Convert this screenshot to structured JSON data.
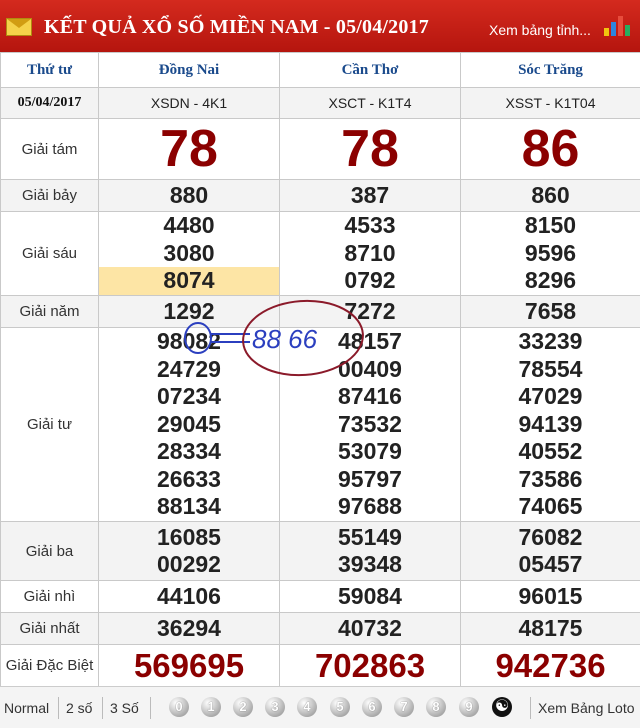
{
  "header": {
    "title": "KẾT QUẢ XỔ SỐ MIỀN NAM - 05/04/2017",
    "view_link": "Xem bảng tỉnh..."
  },
  "table": {
    "day": "Thứ tư",
    "date": "05/04/2017",
    "provinces": [
      {
        "name": "Đồng Nai",
        "code": "XSDN - 4K1"
      },
      {
        "name": "Cần Thơ",
        "code": "XSCT - K1T4"
      },
      {
        "name": "Sóc Trăng",
        "code": "XSST - K1T04"
      }
    ],
    "prizes": {
      "g8": {
        "label": "Giải tám",
        "values": [
          "78",
          "78",
          "86"
        ]
      },
      "g7": {
        "label": "Giải bảy",
        "values": [
          "880",
          "387",
          "860"
        ]
      },
      "g6": {
        "label": "Giải sáu",
        "values": [
          [
            "4480",
            "3080",
            "8074"
          ],
          [
            "4533",
            "8710",
            "0792"
          ],
          [
            "8150",
            "9596",
            "8296"
          ]
        ]
      },
      "g5": {
        "label": "Giải năm",
        "values": [
          "1292",
          "7272",
          "7658"
        ]
      },
      "g4": {
        "label": "Giải tư",
        "values": [
          [
            "98082",
            "24729",
            "07234",
            "29045",
            "28334",
            "26633",
            "88134"
          ],
          [
            "48157",
            "00409",
            "87416",
            "73532",
            "53079",
            "95797",
            "97688"
          ],
          [
            "33239",
            "78554",
            "47029",
            "94139",
            "40552",
            "73586",
            "74065"
          ]
        ]
      },
      "g3": {
        "label": "Giải ba",
        "values": [
          [
            "16085",
            "00292"
          ],
          [
            "55149",
            "39348"
          ],
          [
            "76082",
            "05457"
          ]
        ]
      },
      "g2": {
        "label": "Giải nhì",
        "values": [
          "44106",
          "59084",
          "96015"
        ]
      },
      "g1": {
        "label": "Giải nhất",
        "values": [
          "36294",
          "40732",
          "48175"
        ]
      },
      "db": {
        "label": "Giải Đặc Biệt",
        "values": [
          "569695",
          "702863",
          "942736"
        ]
      }
    }
  },
  "annotation": {
    "text": "88 66"
  },
  "footer": {
    "options": [
      "Normal",
      "2 số",
      "3 Số"
    ],
    "digits": [
      "0",
      "1",
      "2",
      "3",
      "4",
      "5",
      "6",
      "7",
      "8",
      "9"
    ],
    "yin_yang": "☯",
    "more_link": "Xem Bảng Loto"
  },
  "colors": {
    "header_red": "#c41e14",
    "prize_red": "#8b0000",
    "province_blue": "#1a4a8c",
    "highlight": "#fde5a5"
  }
}
